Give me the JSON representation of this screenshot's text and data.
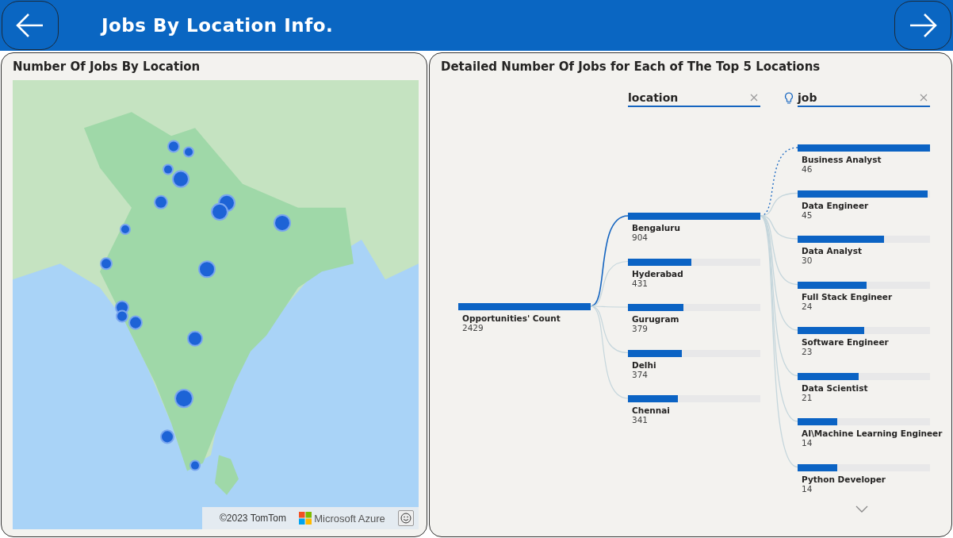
{
  "header": {
    "title": "Jobs By Location Info."
  },
  "map_panel": {
    "title": "Number Of Jobs By Location",
    "attribution": {
      "copyright": "©2023 TomTom",
      "provider": "Microsoft Azure"
    }
  },
  "tree_panel": {
    "title": "Detailed Number Of Jobs for Each of The Top 5 Locations",
    "level_headers": [
      {
        "label": "location",
        "hint": false
      },
      {
        "label": "job",
        "hint": true
      }
    ],
    "root": {
      "name": "Opportunities' Count",
      "value": "2429",
      "level": 1
    },
    "locations": [
      {
        "name": "Bengaluru",
        "value": "904",
        "level": 1,
        "selected": true,
        "children": [
          {
            "name": "Business Analyst",
            "value": "46",
            "level": 1,
            "highlighted": true
          },
          {
            "name": "Data Engineer",
            "value": "45",
            "level": 0.98,
            "highlighted": false
          },
          {
            "name": "Data Analyst",
            "value": "30",
            "level": 0.65,
            "highlighted": false
          },
          {
            "name": "Full Stack Engineer",
            "value": "24",
            "level": 0.52,
            "highlighted": false
          },
          {
            "name": "Software Engineer",
            "value": "23",
            "level": 0.5,
            "highlighted": false
          },
          {
            "name": "Data Scientist",
            "value": "21",
            "level": 0.46,
            "highlighted": false
          },
          {
            "name": "AI\\Machine Learning Engineer",
            "value": "14",
            "level": 0.3,
            "highlighted": false
          },
          {
            "name": "Python Developer",
            "value": "14",
            "level": 0.3,
            "highlighted": false
          }
        ]
      },
      {
        "name": "Hyderabad",
        "value": "431",
        "level": 0.48,
        "selected": false
      },
      {
        "name": "Gurugram",
        "value": "379",
        "level": 0.42,
        "selected": false
      },
      {
        "name": "Delhi",
        "value": "374",
        "level": 0.41,
        "selected": false
      },
      {
        "name": "Chennai",
        "value": "341",
        "level": 0.38,
        "selected": false
      }
    ]
  }
}
